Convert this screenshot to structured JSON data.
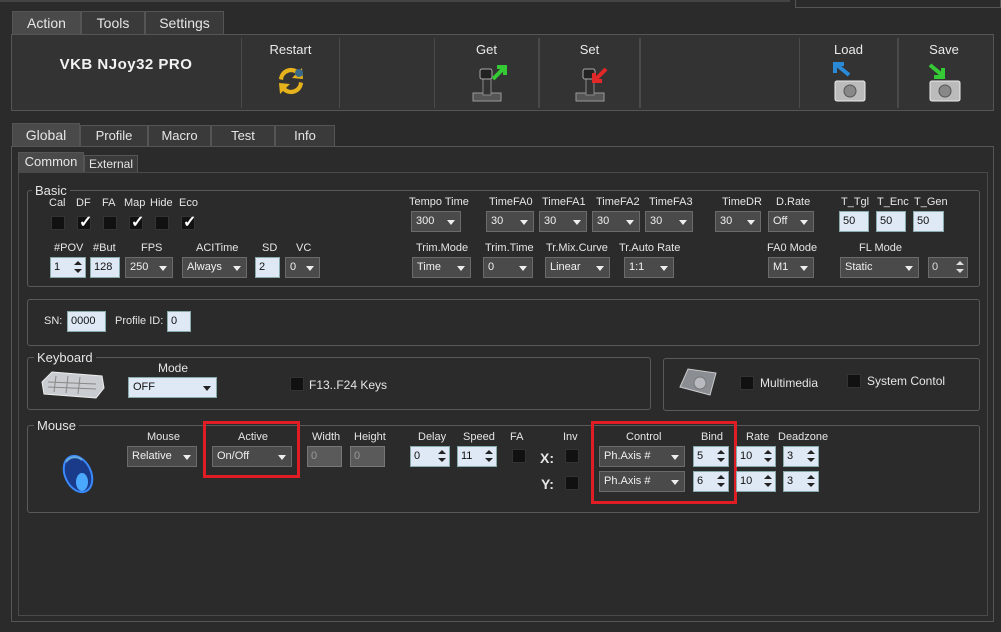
{
  "top_tabs": [
    "Action",
    "Tools",
    "Settings"
  ],
  "device_name": "VKB NJoy32 PRO",
  "toolbar": {
    "restart": "Restart",
    "get": "Get",
    "set": "Set",
    "load": "Load",
    "save": "Save"
  },
  "main_tabs": [
    "Global",
    "Profile",
    "Macro",
    "Test",
    "Info"
  ],
  "sub_tabs": [
    "Common",
    "External"
  ],
  "basic": {
    "legend": "Basic",
    "flags": [
      {
        "label": "Cal",
        "checked": false
      },
      {
        "label": "DF",
        "checked": true
      },
      {
        "label": "FA",
        "checked": false
      },
      {
        "label": "Map",
        "checked": true
      },
      {
        "label": "Hide",
        "checked": false
      },
      {
        "label": "Eco",
        "checked": true
      }
    ],
    "tempo_time": {
      "label": "Tempo Time",
      "value": "300"
    },
    "timefa0": {
      "label": "TimeFA0",
      "value": "30"
    },
    "timefa1": {
      "label": "TimeFA1",
      "value": "30"
    },
    "timefa2": {
      "label": "TimeFA2",
      "value": "30"
    },
    "timefa3": {
      "label": "TimeFA3",
      "value": "30"
    },
    "timedr": {
      "label": "TimeDR",
      "value": "30"
    },
    "drate": {
      "label": "D.Rate",
      "value": "Off"
    },
    "t_tgl": {
      "label": "T_Tgl",
      "value": "50"
    },
    "t_enc": {
      "label": "T_Enc",
      "value": "50"
    },
    "t_gen": {
      "label": "T_Gen",
      "value": "50"
    },
    "pov": {
      "label": "#POV",
      "value": "1"
    },
    "but": {
      "label": "#But",
      "value": "128"
    },
    "fps": {
      "label": "FPS",
      "value": "250"
    },
    "acltime": {
      "label": "ACITime",
      "value": "Always"
    },
    "sd": {
      "label": "SD",
      "value": "2"
    },
    "vc": {
      "label": "VC",
      "value": "0"
    },
    "trim_mode": {
      "label": "Trim.Mode",
      "value": "Time"
    },
    "trim_time": {
      "label": "Trim.Time",
      "value": "0"
    },
    "trmix_curve": {
      "label": "Tr.Mix.Curve",
      "value": "Linear"
    },
    "trauto_rate": {
      "label": "Tr.Auto Rate",
      "value": "1:1"
    },
    "fa0_mode": {
      "label": "FA0 Mode",
      "value": "M1"
    },
    "fl_mode": {
      "label": "FL Mode",
      "value": "Static",
      "num": "0"
    }
  },
  "sn": {
    "label": "SN:",
    "value": "0000"
  },
  "profile_id": {
    "label": "Profile ID:",
    "value": "0"
  },
  "keyboard": {
    "legend": "Keyboard",
    "mode_label": "Mode",
    "mode_value": "OFF",
    "f13_label": "F13..F24 Keys",
    "multimedia_label": "Multimedia",
    "system_label": "System Contol"
  },
  "mouse": {
    "legend": "Mouse",
    "mouse_label": "Mouse",
    "mouse_value": "Relative",
    "active_label": "Active",
    "active_value": "On/Off",
    "width_label": "Width",
    "width_value": "0",
    "height_label": "Height",
    "height_value": "0",
    "delay_label": "Delay",
    "delay_value": "0",
    "speed_label": "Speed",
    "speed_value": "11",
    "fa_label": "FA",
    "inv_label": "Inv",
    "x_label": "X:",
    "y_label": "Y:",
    "control_label": "Control",
    "bind_label": "Bind",
    "rate_label": "Rate",
    "deadzone_label": "Deadzone",
    "rows": [
      {
        "control": "Ph.Axis #",
        "bind": "5",
        "rate": "10",
        "deadzone": "3"
      },
      {
        "control": "Ph.Axis #",
        "bind": "6",
        "rate": "10",
        "deadzone": "3"
      }
    ]
  },
  "highlight_color": "#e01c24"
}
